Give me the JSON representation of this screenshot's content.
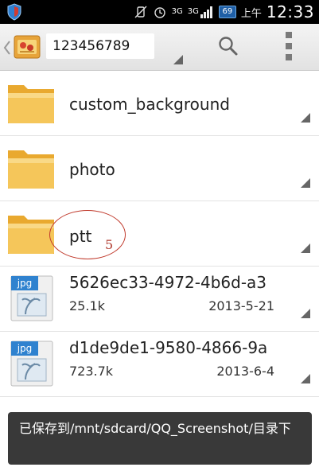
{
  "status_bar": {
    "network_label": "3G",
    "network_label_2": "3G",
    "battery_level": "69",
    "ampm": "上午",
    "time": "12:33"
  },
  "toolbar": {
    "path_value": "123456789"
  },
  "files": [
    {
      "type": "folder",
      "name": "custom_background"
    },
    {
      "type": "folder",
      "name": "photo"
    },
    {
      "type": "folder",
      "name": "ptt"
    },
    {
      "type": "jpg",
      "name": "5626ec33-4972-4b6d-a3",
      "size": "25.1k",
      "date": "2013-5-21",
      "badge": "jpg"
    },
    {
      "type": "jpg",
      "name": "d1de9de1-9580-4866-9a",
      "size": "723.7k",
      "date": "2013-6-4",
      "badge": "jpg"
    }
  ],
  "annotation": {
    "number": "5"
  },
  "toast": {
    "message": "已保存到/mnt/sdcard/QQ_Screenshot/目录下"
  },
  "colors": {
    "status_bar_bg": "#000000",
    "toolbar_bg": "#e8e8e8",
    "folder_yellow": "#f3c04a",
    "annotation_red": "#c0392b",
    "toast_bg": "#2a2a2a"
  }
}
